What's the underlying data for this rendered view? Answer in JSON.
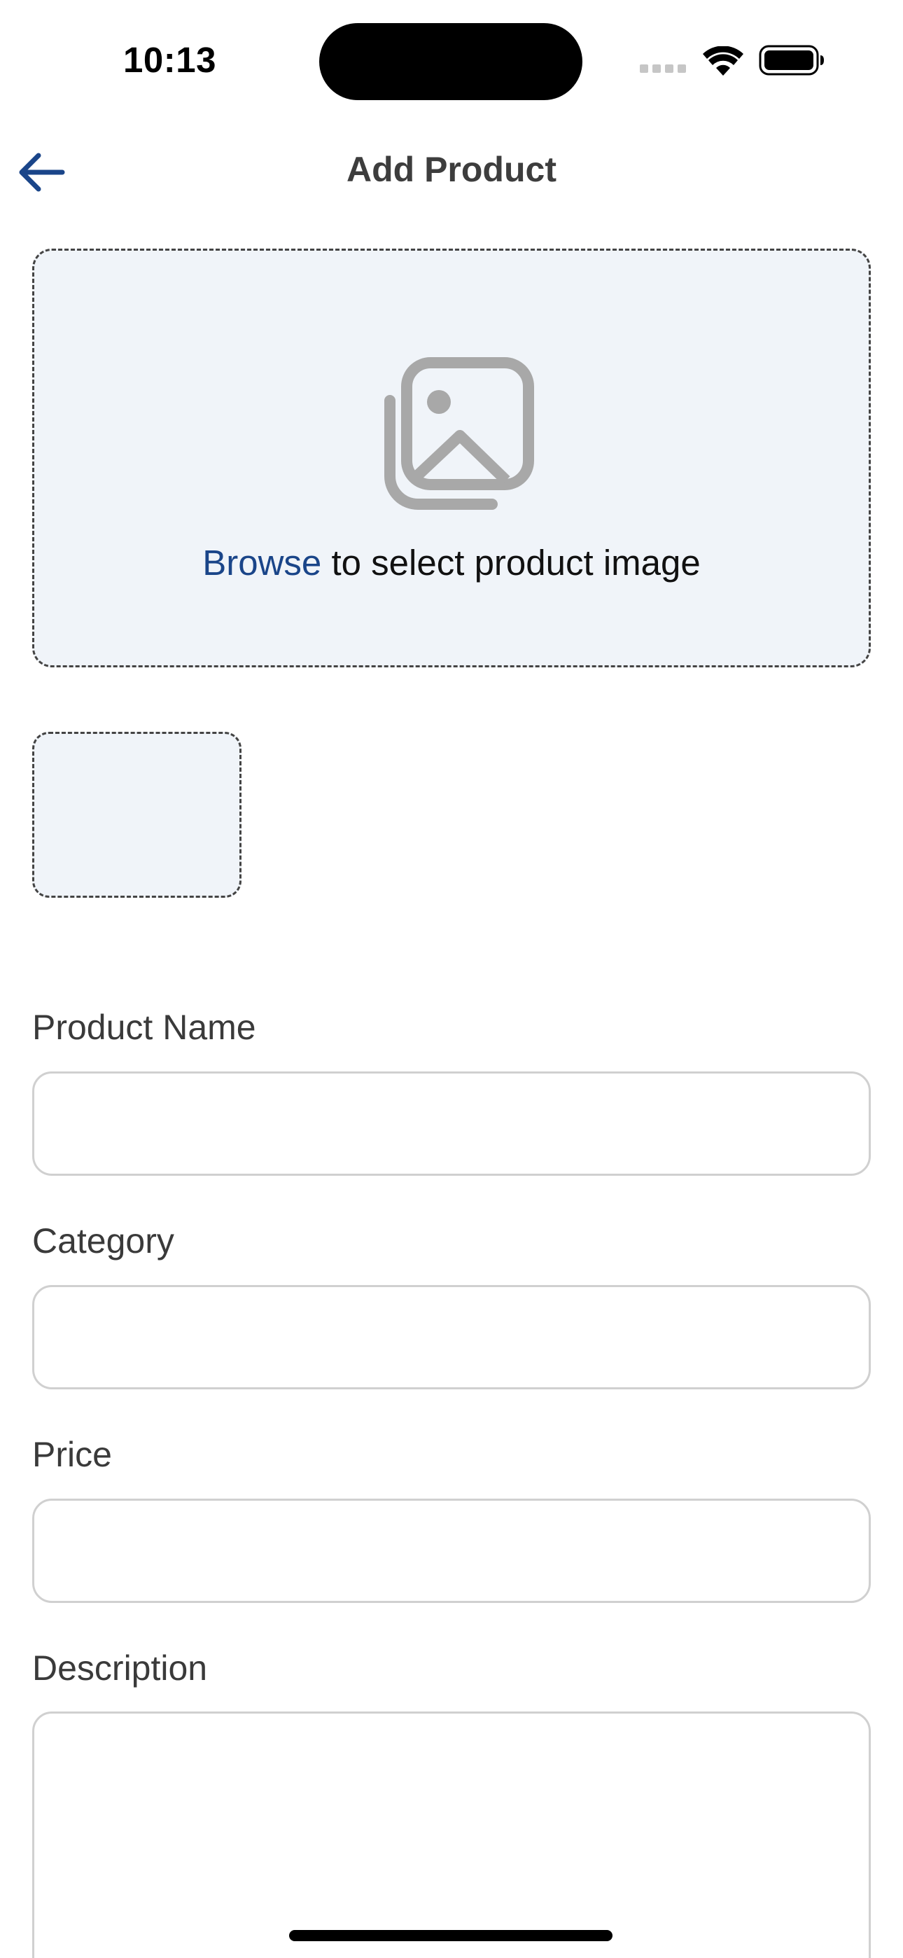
{
  "status_bar": {
    "time": "10:13",
    "signal_icon": "cellular-signal-icon",
    "wifi_icon": "wifi-icon",
    "battery_icon": "battery-icon"
  },
  "nav": {
    "back_icon": "arrow-left-icon",
    "title": "Add Product"
  },
  "upload": {
    "icon": "image-gallery-icon",
    "browse_link": "Browse",
    "text": " to select product image"
  },
  "form": {
    "product_name": {
      "label": "Product Name",
      "value": "",
      "placeholder": ""
    },
    "category": {
      "label": "Category",
      "value": "",
      "placeholder": ""
    },
    "price": {
      "label": "Price",
      "value": "",
      "placeholder": ""
    },
    "description": {
      "label": "Description",
      "value": "",
      "placeholder": ""
    }
  },
  "colors": {
    "accent": "#1a4589",
    "upload_background": "#f0f4f9",
    "input_border": "#d0d0d0",
    "label_text": "#3a3a3a"
  }
}
